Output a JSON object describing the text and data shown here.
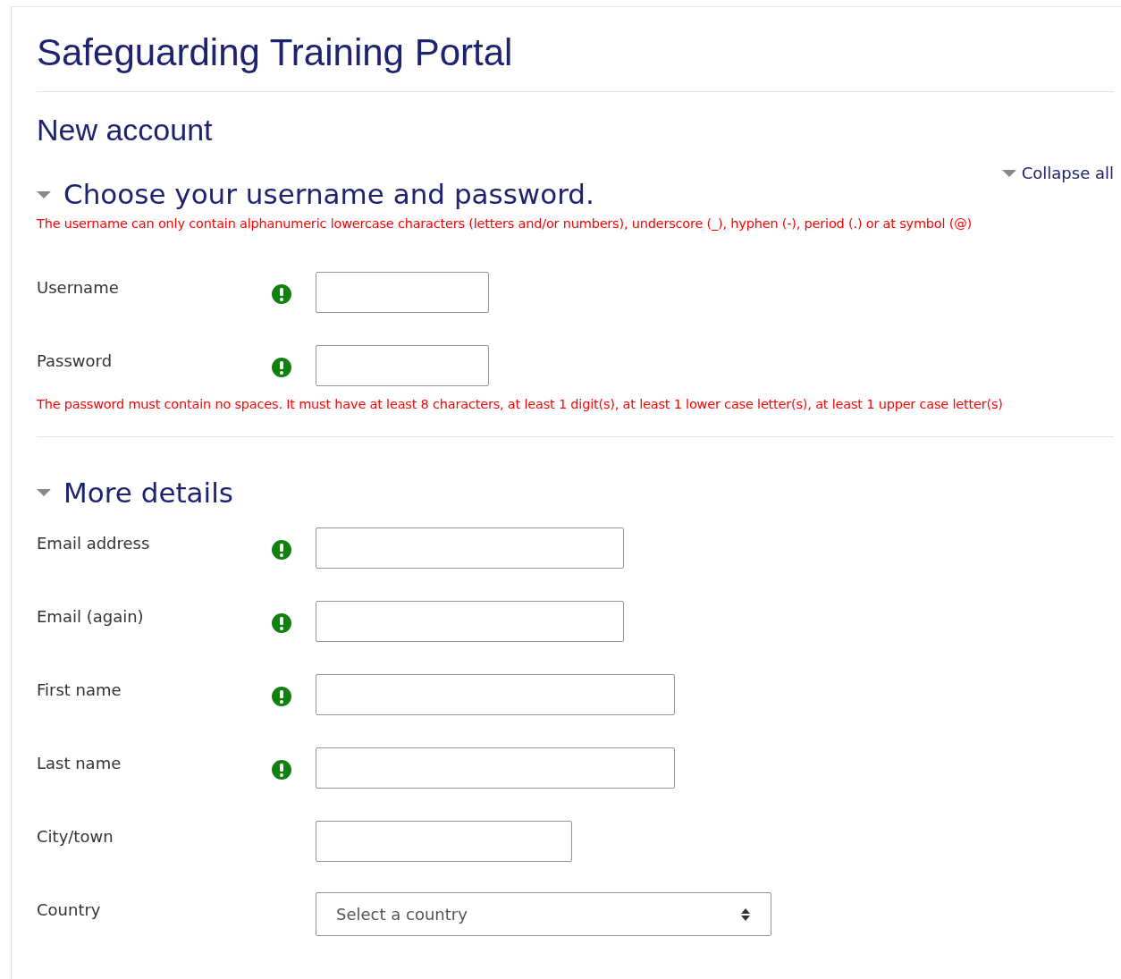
{
  "site_title": "Safeguarding Training Portal",
  "page_heading": "New account",
  "collapse_all": {
    "label": "Collapse all",
    "expanded": true
  },
  "sections": [
    {
      "title": "Choose your username and password.",
      "expanded": true,
      "note_top": "The username can only contain alphanumeric lowercase characters (letters and/or numbers), underscore (_), hyphen (-), period (.) or at symbol (@)",
      "fields": [
        {
          "label": "Username",
          "kind": "text",
          "required": true
        },
        {
          "label": "Password",
          "kind": "password",
          "required": true
        }
      ],
      "note_bottom": "The password must contain no spaces. It must have at least 8 characters, at least 1 digit(s), at least 1 lower case letter(s), at least 1 upper case letter(s)"
    },
    {
      "title": "More details",
      "expanded": true,
      "fields": [
        {
          "label": "Email address",
          "kind": "text",
          "required": true
        },
        {
          "label": "Email (again)",
          "kind": "text",
          "required": true
        },
        {
          "label": "First name",
          "kind": "text",
          "required": true
        },
        {
          "label": "Last name",
          "kind": "text",
          "required": true
        },
        {
          "label": "City/town",
          "kind": "text",
          "required": false
        },
        {
          "label": "Country",
          "kind": "select",
          "required": false,
          "value": "Select a country"
        }
      ]
    }
  ]
}
